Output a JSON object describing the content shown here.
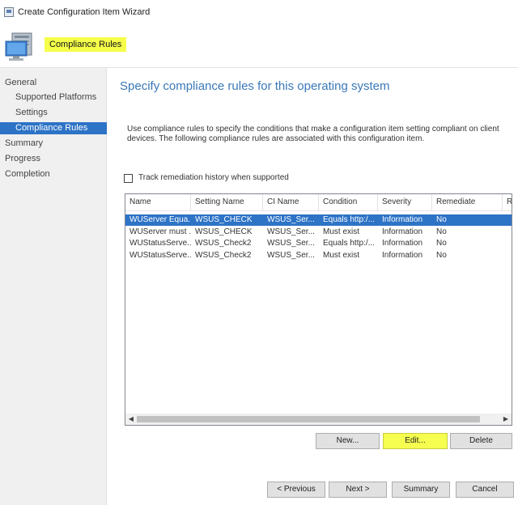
{
  "window": {
    "title": "Create Configuration Item Wizard"
  },
  "header": {
    "page_title": "Compliance Rules",
    "icon": "computer-icon"
  },
  "nav": {
    "items": [
      {
        "label": "General",
        "level": 1,
        "selected": false
      },
      {
        "label": "Supported Platforms",
        "level": 2,
        "selected": false
      },
      {
        "label": "Settings",
        "level": 2,
        "selected": false
      },
      {
        "label": "Compliance Rules",
        "level": 2,
        "selected": true
      },
      {
        "label": "Summary",
        "level": 1,
        "selected": false
      },
      {
        "label": "Progress",
        "level": 1,
        "selected": false
      },
      {
        "label": "Completion",
        "level": 1,
        "selected": false
      }
    ]
  },
  "main": {
    "heading": "Specify compliance rules for this operating system",
    "description": "Use compliance rules to specify the conditions that make a configuration item setting compliant on client devices. The following compliance rules are associated with this configuration item.",
    "track_checkbox": {
      "label": "Track remediation history when supported",
      "checked": false
    },
    "table": {
      "columns": [
        "Name",
        "Setting Name",
        "CI Name",
        "Condition",
        "Severity",
        "Remediate",
        "R"
      ],
      "rows": [
        [
          "WUServer Equa...",
          "WSUS_CHECK",
          "WSUS_Ser...",
          "Equals http:/...",
          "Information",
          "No"
        ],
        [
          "WUServer must ...",
          "WSUS_CHECK",
          "WSUS_Ser...",
          "Must exist",
          "Information",
          "No"
        ],
        [
          "WUStatusServe...",
          "WSUS_Check2",
          "WSUS_Ser...",
          "Equals http:/...",
          "Information",
          "No"
        ],
        [
          "WUStatusServe...",
          "WSUS_Check2",
          "WSUS_Ser...",
          "Must exist",
          "Information",
          "No"
        ]
      ],
      "selected_row": 0
    },
    "buttons": {
      "new": "New...",
      "edit": "Edit...",
      "delete": "Delete"
    }
  },
  "footer": {
    "previous": "< Previous",
    "next": "Next >",
    "summary": "Summary",
    "cancel": "Cancel"
  },
  "colors": {
    "accent": "#2d73c6",
    "highlight": "#f6ff4f",
    "heading": "#3a78b8"
  }
}
